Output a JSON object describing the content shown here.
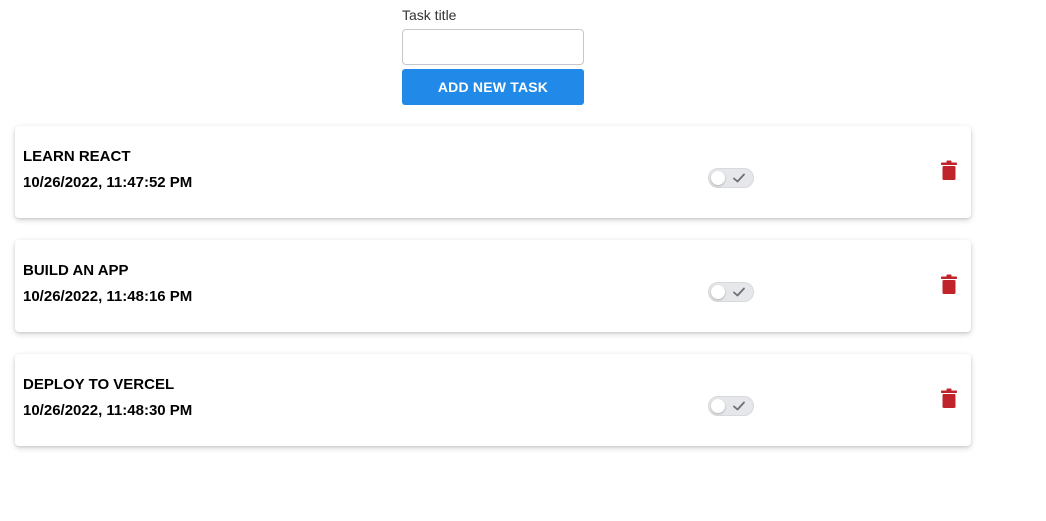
{
  "form": {
    "label": "Task title",
    "input_value": "",
    "input_placeholder": "",
    "add_button_label": "ADD NEW TASK"
  },
  "tasks": [
    {
      "title": "LEARN REACT",
      "date": "10/26/2022, 11:47:52 PM",
      "completed": false,
      "toggle_icon": "check-icon",
      "delete_icon": "trash-icon"
    },
    {
      "title": "BUILD AN APP",
      "date": "10/26/2022, 11:48:16 PM",
      "completed": false,
      "toggle_icon": "check-icon",
      "delete_icon": "trash-icon"
    },
    {
      "title": "DEPLOY TO VERCEL",
      "date": "10/26/2022, 11:48:30 PM",
      "completed": false,
      "toggle_icon": "check-icon",
      "delete_icon": "trash-icon"
    }
  ],
  "colors": {
    "accent": "#2189e8",
    "delete": "#c0242b",
    "toggle_track": "#e6e7ea"
  }
}
